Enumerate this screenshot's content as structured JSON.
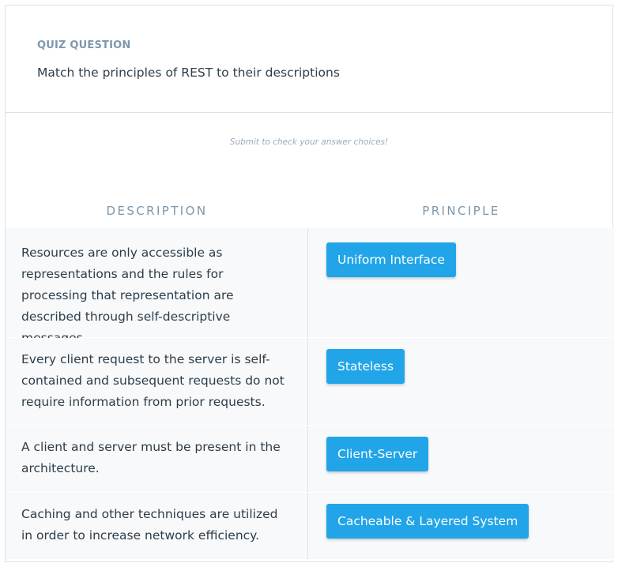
{
  "quiz": {
    "eyebrow": "QUIZ QUESTION",
    "question": "Match the principles of REST to their descriptions",
    "hint": "Submit to check your answer choices!"
  },
  "table": {
    "headers": {
      "description": "DESCRIPTION",
      "principle": "PRINCIPLE"
    },
    "rows": [
      {
        "description": "Resources are only accessible as representations and the rules for processing that representation are described through self-descriptive messages.",
        "principle": "Uniform Interface"
      },
      {
        "description": "Every client request to the server is self-contained and subsequent requests do not require information from prior requests.",
        "principle": "Stateless"
      },
      {
        "description": "A client and server must be present in the architecture.",
        "principle": "Client-Server"
      },
      {
        "description": "Caching and other techniques are utilized in order to increase network efficiency.",
        "principle": "Cacheable & Layered System"
      }
    ]
  },
  "colors": {
    "chip": "#21a5e8",
    "row_bg": "#f7f9fa",
    "header_text": "#7d97ad",
    "body_text": "#2e3d49"
  }
}
